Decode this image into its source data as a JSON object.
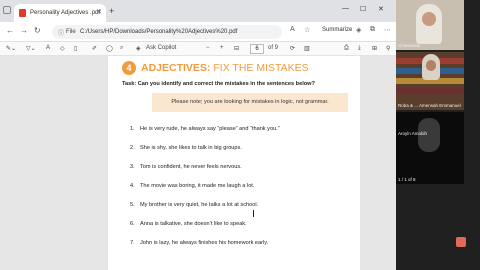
{
  "browser": {
    "tab_title": "Personality Adjectives .pdf",
    "new_tab": "+",
    "file_label": "File",
    "url": "C:/Users/HP/Downloads/Personality%20Adjectives%20.pdf",
    "summarize_label": "Summarize",
    "ask_copilot_label": "Ask Copilot",
    "page_number": "6",
    "page_total": "of 9"
  },
  "document": {
    "section_number": "4",
    "heading_bold": "ADJECTIVES:",
    "heading_rest": "FIX THE MISTAKES",
    "task_label": "Task:",
    "task_text": "Can you identify and correct the mistakes in the sentences below?",
    "note": "Please note; you are looking for mistakes in logic, not grammar.",
    "sentences": [
      {
        "num": "1.",
        "text": "He is very rude, he always say “please” and “thank you.”"
      },
      {
        "num": "2.",
        "text": "She is shy, she likes to talk in big groups."
      },
      {
        "num": "3.",
        "text": "Tom is confident, he never feels nervous."
      },
      {
        "num": "4.",
        "text": "The movie was boring, it made me laugh a lot."
      },
      {
        "num": "5.",
        "text": "My brother is very quiet, he talks a lot at school."
      },
      {
        "num": "6.",
        "text": "Anna is talkative, she doesn’t like to speak."
      },
      {
        "num": "7.",
        "text": "John is lazy, he always finishes his homework early."
      }
    ]
  },
  "participants": [
    {
      "label": "Chinwendu"
    },
    {
      "label": "Roba & ... Amensah Emmanuel"
    },
    {
      "label": "Aroyin Amobih"
    },
    {
      "label": "1 / 1 of 8"
    }
  ],
  "colors": {
    "accent": "#f29b3c",
    "note_bg": "#fbe7cf"
  }
}
